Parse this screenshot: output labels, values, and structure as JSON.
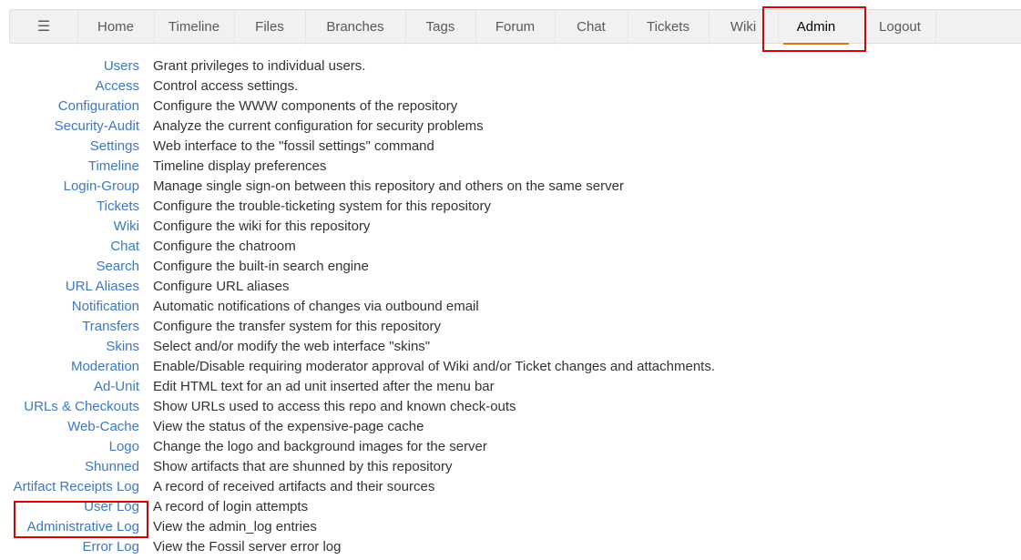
{
  "nav": {
    "menu_icon": "☰",
    "items": [
      {
        "label": "Home"
      },
      {
        "label": "Timeline"
      },
      {
        "label": "Files"
      },
      {
        "label": "Branches"
      },
      {
        "label": "Tags"
      },
      {
        "label": "Forum"
      },
      {
        "label": "Chat"
      },
      {
        "label": "Tickets"
      },
      {
        "label": "Wiki"
      },
      {
        "label": "Admin",
        "active": true
      },
      {
        "label": "Logout"
      }
    ],
    "active_color": "#e8720c"
  },
  "admin_items": [
    {
      "link": "Users",
      "desc": "Grant privileges to individual users."
    },
    {
      "link": "Access",
      "desc": "Control access settings."
    },
    {
      "link": "Configuration",
      "desc": "Configure the WWW components of the repository"
    },
    {
      "link": "Security-Audit",
      "desc": "Analyze the current configuration for security problems"
    },
    {
      "link": "Settings",
      "desc": "Web interface to the \"fossil settings\" command"
    },
    {
      "link": "Timeline",
      "desc": "Timeline display preferences"
    },
    {
      "link": "Login-Group",
      "desc": "Manage single sign-on between this repository and others on the same server"
    },
    {
      "link": "Tickets",
      "desc": "Configure the trouble-ticketing system for this repository"
    },
    {
      "link": "Wiki",
      "desc": "Configure the wiki for this repository"
    },
    {
      "link": "Chat",
      "desc": "Configure the chatroom"
    },
    {
      "link": "Search",
      "desc": "Configure the built-in search engine"
    },
    {
      "link": "URL Aliases",
      "desc": "Configure URL aliases"
    },
    {
      "link": "Notification",
      "desc": "Automatic notifications of changes via outbound email"
    },
    {
      "link": "Transfers",
      "desc": "Configure the transfer system for this repository"
    },
    {
      "link": "Skins",
      "desc": "Select and/or modify the web interface \"skins\""
    },
    {
      "link": "Moderation",
      "desc": "Enable/Disable requiring moderator approval of Wiki and/or Ticket changes and attachments."
    },
    {
      "link": "Ad-Unit",
      "desc": "Edit HTML text for an ad unit inserted after the menu bar"
    },
    {
      "link": "URLs & Checkouts",
      "desc": "Show URLs used to access this repo and known check-outs"
    },
    {
      "link": "Web-Cache",
      "desc": "View the status of the expensive-page cache"
    },
    {
      "link": "Logo",
      "desc": "Change the logo and background images for the server"
    },
    {
      "link": "Shunned",
      "desc": "Show artifacts that are shunned by this repository"
    },
    {
      "link": "Artifact Receipts Log",
      "desc": "A record of received artifacts and their sources"
    },
    {
      "link": "User Log",
      "desc": "A record of login attempts"
    },
    {
      "link": "Administrative Log",
      "desc": "View the admin_log entries"
    },
    {
      "link": "Error Log",
      "desc": "View the Fossil server error log"
    }
  ],
  "colors": {
    "link": "#3c78c3",
    "highlight": "#e00000"
  }
}
